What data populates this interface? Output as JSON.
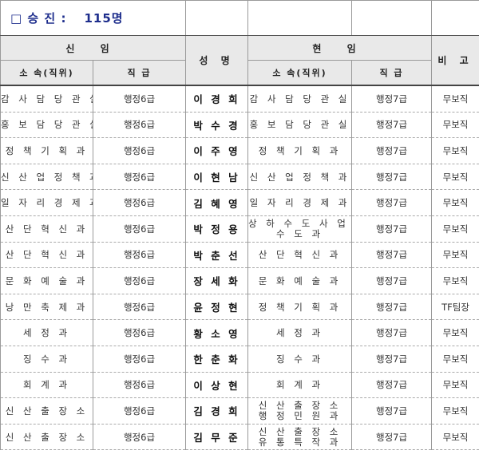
{
  "title": {
    "prefix": "□ 승   진 :",
    "count": "115명"
  },
  "headers": {
    "new_post": "신 임",
    "name": "성 명",
    "current_post": "현 임",
    "note": "비 고",
    "affiliation": "소 속(직위)",
    "rank": "직 급"
  },
  "rows": [
    {
      "new_dept": "감 사 담 당 관 실",
      "new_rank": "행정6급",
      "name": "이 경 희",
      "cur_dept": [
        "감 사 담 당 관 실"
      ],
      "cur_rank": "행정7급",
      "note": "무보직"
    },
    {
      "new_dept": "홍 보 담 당 관 실",
      "new_rank": "행정6급",
      "name": "박 수 경",
      "cur_dept": [
        "홍 보 담 당 관 실"
      ],
      "cur_rank": "행정7급",
      "note": "무보직"
    },
    {
      "new_dept": "정 책 기 획 과",
      "new_rank": "행정6급",
      "name": "이 주 영",
      "cur_dept": [
        "정 책 기 획 과"
      ],
      "cur_rank": "행정7급",
      "note": "무보직"
    },
    {
      "new_dept": "신 산 업 정 책 과",
      "new_rank": "행정6급",
      "name": "이 현 남",
      "cur_dept": [
        "신 산 업 정 책 과"
      ],
      "cur_rank": "행정7급",
      "note": "무보직"
    },
    {
      "new_dept": "일 자 리 경 제 과",
      "new_rank": "행정6급",
      "name": "김 혜 영",
      "cur_dept": [
        "일 자 리 경 제 과"
      ],
      "cur_rank": "행정7급",
      "note": "무보직"
    },
    {
      "new_dept": "산 단 혁 신 과",
      "new_rank": "행정6급",
      "name": "박 정 용",
      "cur_dept": [
        "상 하 수 도 사 업 소",
        "수    도    과"
      ],
      "cur_rank": "행정7급",
      "note": "무보직"
    },
    {
      "new_dept": "산 단 혁 신 과",
      "new_rank": "행정6급",
      "name": "박 춘 선",
      "cur_dept": [
        "산 단 혁 신 과"
      ],
      "cur_rank": "행정7급",
      "note": "무보직"
    },
    {
      "new_dept": "문 화 예 술 과",
      "new_rank": "행정6급",
      "name": "장 세 화",
      "cur_dept": [
        "문 화 예 술 과"
      ],
      "cur_rank": "행정7급",
      "note": "무보직"
    },
    {
      "new_dept": "낭 만 축 제 과",
      "new_rank": "행정6급",
      "name": "윤 정 현",
      "cur_dept": [
        "정 책 기 획 과"
      ],
      "cur_rank": "행정7급",
      "note": "TF팀장"
    },
    {
      "new_dept": "세      정      과",
      "new_rank": "행정6급",
      "name": "황 소 영",
      "cur_dept": [
        "세    정    과"
      ],
      "cur_rank": "행정7급",
      "note": "무보직"
    },
    {
      "new_dept": "징      수      과",
      "new_rank": "행정6급",
      "name": "한 춘 화",
      "cur_dept": [
        "징    수    과"
      ],
      "cur_rank": "행정7급",
      "note": "무보직"
    },
    {
      "new_dept": "회      계      과",
      "new_rank": "행정6급",
      "name": "이 상 현",
      "cur_dept": [
        "회    계    과"
      ],
      "cur_rank": "행정7급",
      "note": "무보직"
    },
    {
      "new_dept": "신 산 출 장 소",
      "new_rank": "행정6급",
      "name": "김 경 희",
      "cur_dept": [
        "신 산 출 장 소",
        "행 정 민 원 과"
      ],
      "cur_rank": "행정7급",
      "note": "무보직"
    },
    {
      "new_dept": "신 산 출 장 소",
      "new_rank": "행정6급",
      "name": "김 무 준",
      "cur_dept": [
        "신 산 출 장 소",
        "유 통 특 작 과"
      ],
      "cur_rank": "행정7급",
      "note": "무보직"
    }
  ]
}
